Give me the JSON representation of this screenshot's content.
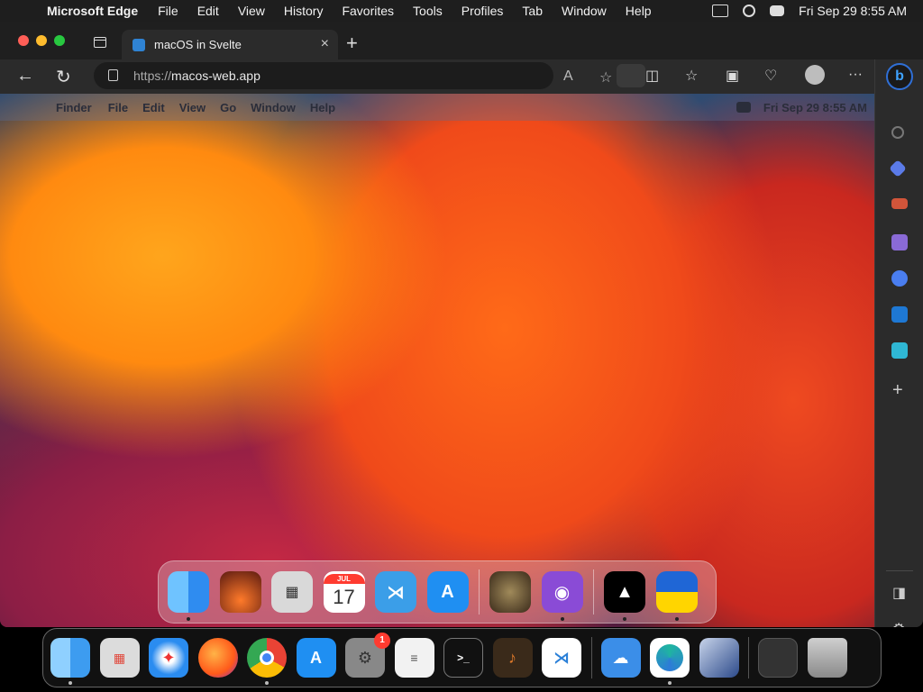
{
  "host_menubar": {
    "app_name": "Microsoft Edge",
    "menus": [
      "File",
      "Edit",
      "View",
      "History",
      "Favorites",
      "Tools",
      "Profiles",
      "Tab",
      "Window",
      "Help"
    ],
    "clock": "Fri Sep 29  8:55 AM"
  },
  "browser": {
    "tab": {
      "title": "macOS in Svelte"
    },
    "address": {
      "protocol": "https://",
      "host": "macos-web.app"
    }
  },
  "inner_menubar": {
    "app_name": "Finder",
    "menus": [
      "File",
      "Edit",
      "View",
      "Go",
      "Window",
      "Help"
    ],
    "clock": "Fri Sep 29  8:55 AM"
  },
  "inner_dock": [
    {
      "name": "finder",
      "color": "#2f8cf0",
      "running": true
    },
    {
      "name": "wallpapers",
      "color": "#7a2a1a",
      "running": false
    },
    {
      "name": "calculator",
      "color": "#d9d9d9",
      "running": false
    },
    {
      "name": "calendar",
      "color": "#ffffff",
      "month": "JUL",
      "day": "17",
      "running": false
    },
    {
      "name": "vscode",
      "color": "#3b9ee8",
      "running": false
    },
    {
      "name": "appstore",
      "color": "#1f8ff2",
      "running": false
    },
    {
      "name": "purrcy",
      "color": "#6b5a3e",
      "running": false
    },
    {
      "name": "github",
      "color": "#8a4bd6",
      "running": true
    },
    {
      "name": "vercel",
      "color": "#000000",
      "running": true
    },
    {
      "name": "ukraine",
      "color": "#ffd500",
      "running": true
    }
  ],
  "host_dock": [
    {
      "name": "finder",
      "color": "#3d9cf0",
      "running": true
    },
    {
      "name": "launchpad",
      "color": "#dcdcdc",
      "running": false
    },
    {
      "name": "safari",
      "color": "#2a8cf0",
      "running": false
    },
    {
      "name": "firefox",
      "color": "#ff7a1a",
      "running": false
    },
    {
      "name": "chrome",
      "color": "#ffffff",
      "running": true
    },
    {
      "name": "appstore",
      "color": "#1f8ff2",
      "running": false
    },
    {
      "name": "system-settings",
      "color": "#888888",
      "badge": "1",
      "running": false
    },
    {
      "name": "textedit",
      "color": "#f2f2f2",
      "running": false
    },
    {
      "name": "terminal",
      "color": "#111111",
      "running": false
    },
    {
      "name": "garageband",
      "color": "#3a2a1a",
      "running": false
    },
    {
      "name": "vscode",
      "color": "#2b80d8",
      "running": false
    },
    {
      "name": "weather",
      "color": "#3b8ee8",
      "running": false
    },
    {
      "name": "edge",
      "color": "#ffffff",
      "running": true
    },
    {
      "name": "virtualbox",
      "color": "#2c4a8a",
      "running": false
    },
    {
      "name": "downloads-stack",
      "color": "#333333",
      "running": false
    },
    {
      "name": "trash",
      "color": "#9a9a9a",
      "running": false
    }
  ]
}
